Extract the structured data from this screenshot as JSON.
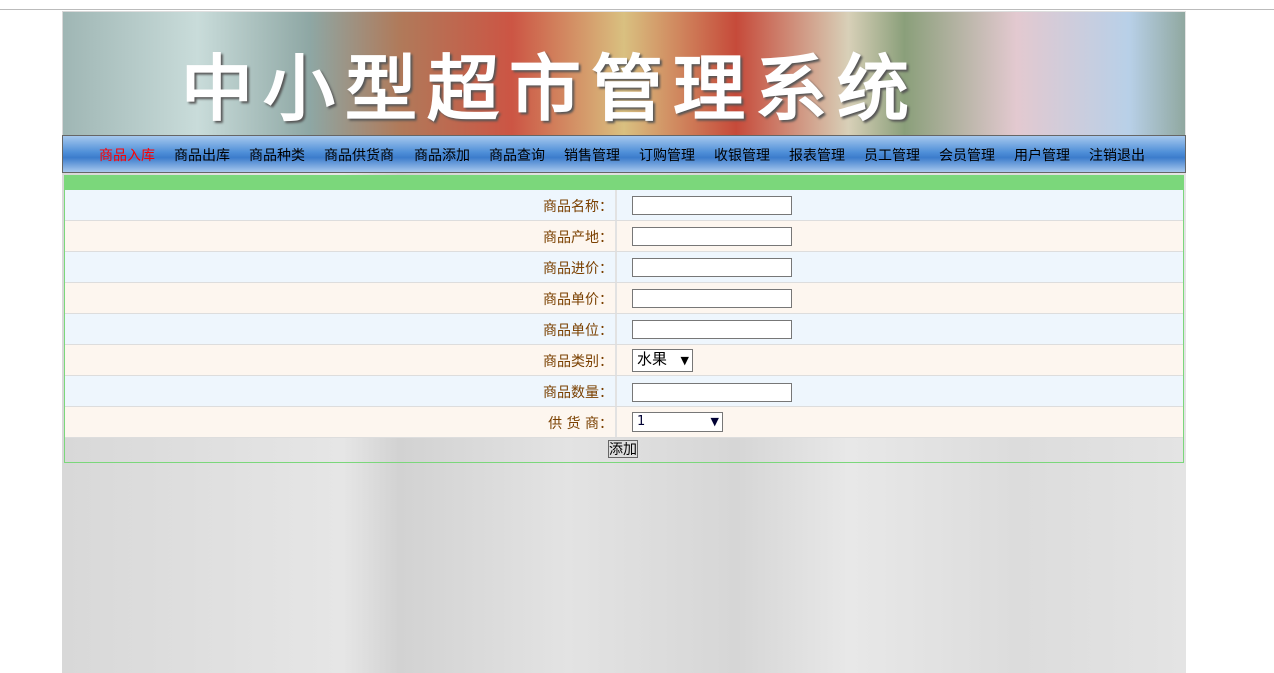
{
  "banner": {
    "title": "中小型超市管理系统"
  },
  "nav": [
    {
      "label": "商品入库",
      "active": true
    },
    {
      "label": "商品出库"
    },
    {
      "label": "商品种类"
    },
    {
      "label": "商品供货商"
    },
    {
      "label": "商品添加"
    },
    {
      "label": "商品查询"
    },
    {
      "label": "销售管理"
    },
    {
      "label": "订购管理"
    },
    {
      "label": "收银管理"
    },
    {
      "label": "报表管理"
    },
    {
      "label": "员工管理"
    },
    {
      "label": "会员管理"
    },
    {
      "label": "用户管理"
    },
    {
      "label": "注销退出"
    }
  ],
  "form": {
    "name_label": "商品名称：",
    "origin_label": "商品产地：",
    "cost_label": "商品进价：",
    "price_label": "商品单价：",
    "unit_label": "商品单位：",
    "category_label": "商品类别：",
    "category_value": "水果",
    "quantity_label": "商品数量：",
    "supplier_label": "供 货 商：",
    "supplier_value": "1",
    "submit": "添加"
  }
}
